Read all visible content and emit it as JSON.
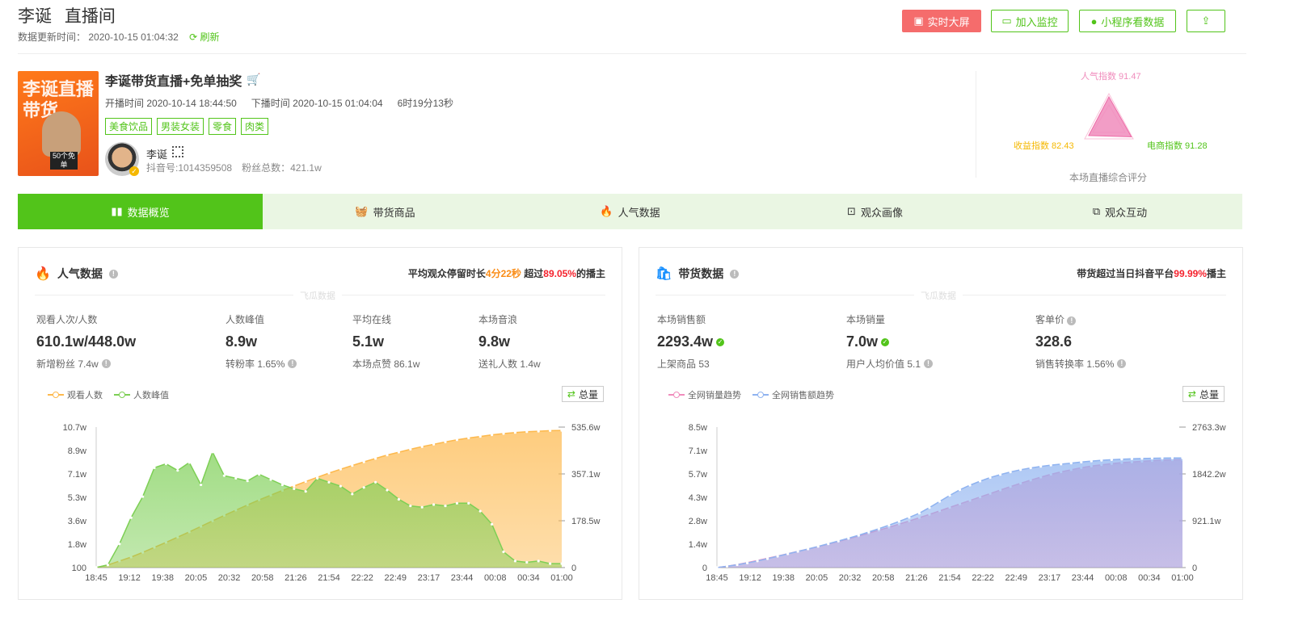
{
  "header": {
    "name": "李诞",
    "room": "直播间",
    "update_label": "数据更新时间：",
    "update_time": "2020-10-15 01:04:32",
    "refresh": "刷新",
    "buttons": {
      "big_screen": "实时大屏",
      "monitor": "加入监控",
      "mini_program": "小程序看数据"
    }
  },
  "live": {
    "title": "李诞带货直播+免单抽奖",
    "cover_text": "李诞直播带货",
    "cover_badge": "50个免单",
    "start_label": "开播时间",
    "start_time": "2020-10-14 18:44:50",
    "end_label": "下播时间",
    "end_time": "2020-10-15 01:04:04",
    "duration": "6时19分13秒",
    "tags": [
      "美食饮品",
      "男装女装",
      "零食",
      "肉类"
    ],
    "host_name": "李诞",
    "douyin_id": "抖音号:1014359508",
    "fans": "粉丝总数：421.1w"
  },
  "score": {
    "popularity": "人气指数 91.47",
    "ecommerce": "电商指数 91.28",
    "revenue": "收益指数 82.43",
    "caption": "本场直播综合评分",
    "values": {
      "popularity": 91.47,
      "ecommerce": 91.28,
      "revenue": 82.43
    }
  },
  "tabs": [
    "数据概览",
    "带货商品",
    "人气数据",
    "观众画像",
    "观众互动"
  ],
  "popularity_card": {
    "title": "人气数据",
    "summary_pre": "平均观众停留时长",
    "stay": "4分22秒",
    "summary_mid": " 超过",
    "pct": "89.05%",
    "summary_post": "的播主",
    "watermark": "飞瓜数据",
    "stats": [
      {
        "label": "观看人次/人数",
        "value": "610.1w/448.0w",
        "sub": "新增粉丝 7.4w"
      },
      {
        "label": "人数峰值",
        "value": "8.9w",
        "sub": "转粉率 1.65%"
      },
      {
        "label": "平均在线",
        "value": "5.1w",
        "sub": "本场点赞 86.1w"
      },
      {
        "label": "本场音浪",
        "value": "9.8w",
        "sub": "送礼人数 1.4w"
      }
    ],
    "legend": [
      "观看人数",
      "人数峰值"
    ],
    "total_btn": "总量"
  },
  "sales_card": {
    "title": "带货数据",
    "summary_pre": "带货超过当日抖音平台",
    "pct": "99.99%",
    "summary_post": "播主",
    "watermark": "飞瓜数据",
    "stats": [
      {
        "label": "本场销售额",
        "value": "2293.4w",
        "sub": "上架商品 53"
      },
      {
        "label": "本场销量",
        "value": "7.0w",
        "sub": "用户人均价值 5.1"
      },
      {
        "label": "客单价",
        "value": "328.6",
        "sub": "销售转换率 1.56%"
      }
    ],
    "legend": [
      "全网销量趋势",
      "全网销售额趋势"
    ],
    "total_btn": "总量"
  },
  "chart_data": [
    {
      "type": "area",
      "x_ticks": [
        "18:45",
        "19:12",
        "19:38",
        "20:05",
        "20:32",
        "20:58",
        "21:26",
        "21:54",
        "22:22",
        "22:49",
        "23:17",
        "23:44",
        "00:08",
        "00:34",
        "01:00"
      ],
      "y_left_ticks": [
        "100",
        "1.8w",
        "3.6w",
        "5.3w",
        "7.1w",
        "8.9w",
        "10.7w"
      ],
      "y_left_max": 107000,
      "y_right_ticks": [
        "0",
        "178.5w",
        "357.1w",
        "535.6w"
      ],
      "y_right_max": 535.6,
      "series": [
        {
          "name": "观看人数",
          "axis": "right",
          "color": "#fdb94d",
          "values": [
            0,
            10,
            25,
            40,
            58,
            77,
            96,
            116,
            136,
            157,
            178,
            199,
            219,
            239,
            258,
            276,
            294,
            311,
            328,
            344,
            360,
            375,
            389,
            403,
            416,
            429,
            440,
            451,
            461,
            470,
            479,
            487,
            494,
            500,
            506,
            511,
            515,
            518,
            520,
            522,
            523
          ]
        },
        {
          "name": "人数峰值",
          "axis": "left",
          "color": "#7dcf55",
          "values": [
            100,
            2000,
            18000,
            38000,
            54000,
            76000,
            79000,
            74000,
            80000,
            63000,
            88000,
            70000,
            68000,
            66000,
            71000,
            67000,
            63000,
            60000,
            58000,
            68000,
            65000,
            62000,
            56000,
            61000,
            65000,
            59000,
            52000,
            47000,
            46000,
            48000,
            47000,
            49000,
            49000,
            43000,
            33000,
            12000,
            5000,
            4000,
            5000,
            3000,
            3000
          ]
        }
      ]
    },
    {
      "type": "area",
      "x_ticks": [
        "18:45",
        "19:12",
        "19:38",
        "20:05",
        "20:32",
        "20:58",
        "21:26",
        "21:54",
        "22:22",
        "22:49",
        "23:17",
        "23:44",
        "00:08",
        "00:34",
        "01:00"
      ],
      "y_left_ticks": [
        "0",
        "1.4w",
        "2.8w",
        "4.3w",
        "5.7w",
        "7.1w",
        "8.5w"
      ],
      "y_left_max": 85000,
      "y_right_ticks": [
        "0",
        "921.1w",
        "1842.2w",
        "2763.3w"
      ],
      "y_right_max": 2763.3,
      "series": [
        {
          "name": "全网销量趋势",
          "axis": "left",
          "color": "#f08cbc",
          "values": [
            0,
            800,
            1800,
            3000,
            4300,
            5600,
            7000,
            8400,
            9800,
            11200,
            12700,
            14200,
            15800,
            17400,
            19100,
            20800,
            22600,
            24400,
            26300,
            28200,
            30200,
            32200,
            34300,
            36400,
            38500,
            40600,
            42700,
            44800,
            46900,
            49000,
            51000,
            52900,
            54700,
            56400,
            57900,
            59200,
            60400,
            61400,
            62200,
            62900,
            63500,
            63900,
            64300,
            64700,
            65000,
            65200,
            65300
          ]
        },
        {
          "name": "全网销售额趋势",
          "axis": "right",
          "color": "#8fb3f0",
          "values": [
            0,
            25,
            55,
            90,
            130,
            175,
            222,
            270,
            318,
            366,
            416,
            468,
            522,
            578,
            636,
            698,
            764,
            834,
            908,
            986,
            1070,
            1180,
            1300,
            1420,
            1530,
            1620,
            1700,
            1770,
            1830,
            1880,
            1925,
            1960,
            1990,
            2015,
            2035,
            2055,
            2075,
            2095,
            2110,
            2122,
            2132,
            2140,
            2146,
            2151,
            2154,
            2156,
            2157
          ]
        }
      ]
    }
  ]
}
